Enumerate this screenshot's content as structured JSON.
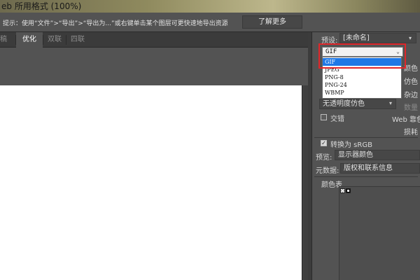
{
  "window": {
    "title": "eb 所用格式 (100%)"
  },
  "hint": {
    "text": "提示：使用“文件”>“导出”>“导出为...”或右键单击某个图层可更快速地导出资源",
    "button": "了解更多"
  },
  "tabs": [
    {
      "label": "原稿"
    },
    {
      "label": "优化"
    },
    {
      "label": "双联"
    },
    {
      "label": "四联"
    }
  ],
  "panel": {
    "preset_label": "预设:",
    "preset_value": "[未命名]",
    "format_selected": "GIF",
    "format_options": [
      "GIF",
      "JPEG",
      "PNG-8",
      "PNG-24",
      "WBMP"
    ],
    "right_labels": {
      "colors": "颜色",
      "dither_pct": "仿色",
      "matte": "杂边",
      "amount": "数量",
      "web_snap": "Web 靠色",
      "lossy": "损耗"
    },
    "transparency_dither": "无透明度仿色",
    "interlaced_label": "交错",
    "convert_srgb_label": "转换为 sRGB",
    "preview_label": "预览:",
    "preview_value": "显示器颜色",
    "metadata_label": "元数据:",
    "metadata_value": "版权和联系信息",
    "color_table_label": "颜色表"
  },
  "colors": {
    "highlight": "#e0262a",
    "selection": "#1e78e6"
  }
}
